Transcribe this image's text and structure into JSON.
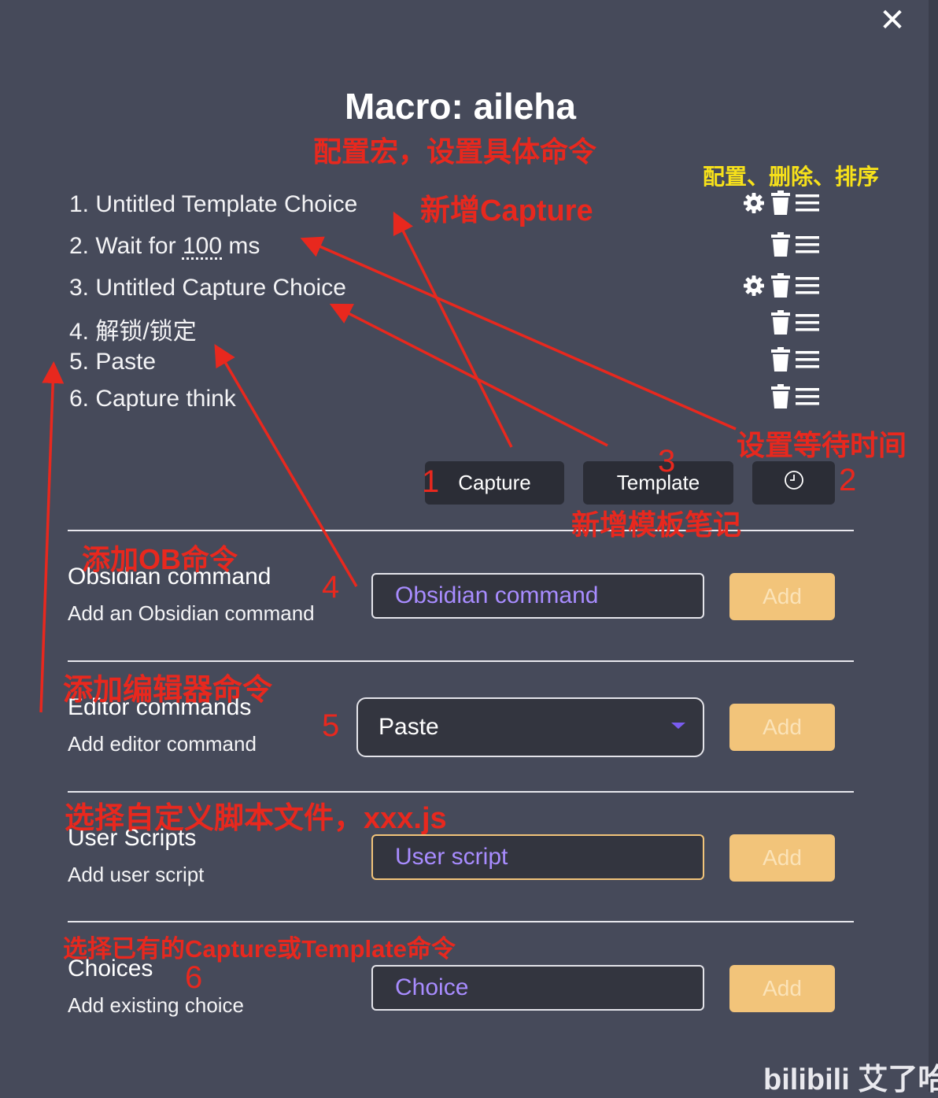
{
  "window": {
    "close_icon": "close-icon",
    "title": "Macro: aileha"
  },
  "steps": [
    {
      "index": "1.",
      "label": "Untitled Template Choice",
      "configurable": true
    },
    {
      "index": "2.",
      "prefix": "Wait for",
      "value": "100",
      "suffix": "ms",
      "configurable": false
    },
    {
      "index": "3.",
      "label": "Untitled Capture Choice",
      "configurable": true
    },
    {
      "index": "4.",
      "label": "解锁/锁定",
      "configurable": false
    },
    {
      "index": "5.",
      "label": "Paste",
      "configurable": false
    },
    {
      "index": "6.",
      "label": "Capture think",
      "configurable": false
    }
  ],
  "row_icons": [
    "gear-icon",
    "trash-icon",
    "drag-handle-icon"
  ],
  "buttons": {
    "capture": "Capture",
    "template": "Template",
    "wait": "clock-icon"
  },
  "sections": {
    "obsidian": {
      "title": "Obsidian command",
      "desc": "Add an Obsidian command",
      "placeholder": "Obsidian command",
      "add": "Add"
    },
    "editor": {
      "title": "Editor commands",
      "desc": "Add editor command",
      "selected": "Paste",
      "add": "Add"
    },
    "scripts": {
      "title": "User Scripts",
      "desc": "Add user script",
      "placeholder": "User script",
      "add": "Add"
    },
    "choices": {
      "title": "Choices",
      "desc": "Add existing choice",
      "placeholder": "Choice",
      "add": "Add"
    }
  },
  "annotations": {
    "configure_macro": "配置宏，设置具体命令",
    "config_delete_sort": "配置、删除、排序",
    "new_capture": "新增Capture",
    "set_wait": "设置等待时间",
    "new_template": "新增模板笔记",
    "add_ob": "添加OB命令",
    "add_editor": "添加编辑器命令",
    "user_script": "选择自定义脚本文件，xxx.js",
    "existing_choice": "选择已有的Capture或Template命令",
    "n1": "1",
    "n2": "2",
    "n3": "3",
    "n4": "4",
    "n5": "5",
    "n6": "6"
  },
  "watermark": "bilibili 艾了哈",
  "colors": {
    "background": "#464a5a",
    "annotation_red": "#e8281e",
    "annotation_yellow": "#f7e11a",
    "add_button": "#f2c47a",
    "placeholder": "#a88cff"
  }
}
